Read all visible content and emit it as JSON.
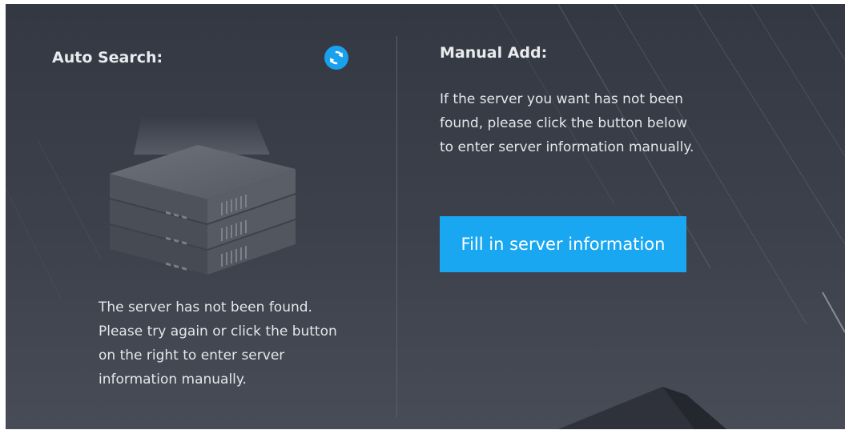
{
  "auto_search": {
    "title": "Auto Search:",
    "refresh_icon": "refresh-icon",
    "illustration_icon": "server-stack-icon",
    "not_found_message": "The server has not been found. Please try again or click the button on the right to enter server information manually."
  },
  "manual_add": {
    "title": "Manual Add:",
    "description": "If the server you want has not been found, please click the button below to enter server information manually.",
    "button_label": "Fill in server information"
  },
  "colors": {
    "background": "#3a3e48",
    "accent": "#19a7f2",
    "text": "#e4e6ea"
  }
}
